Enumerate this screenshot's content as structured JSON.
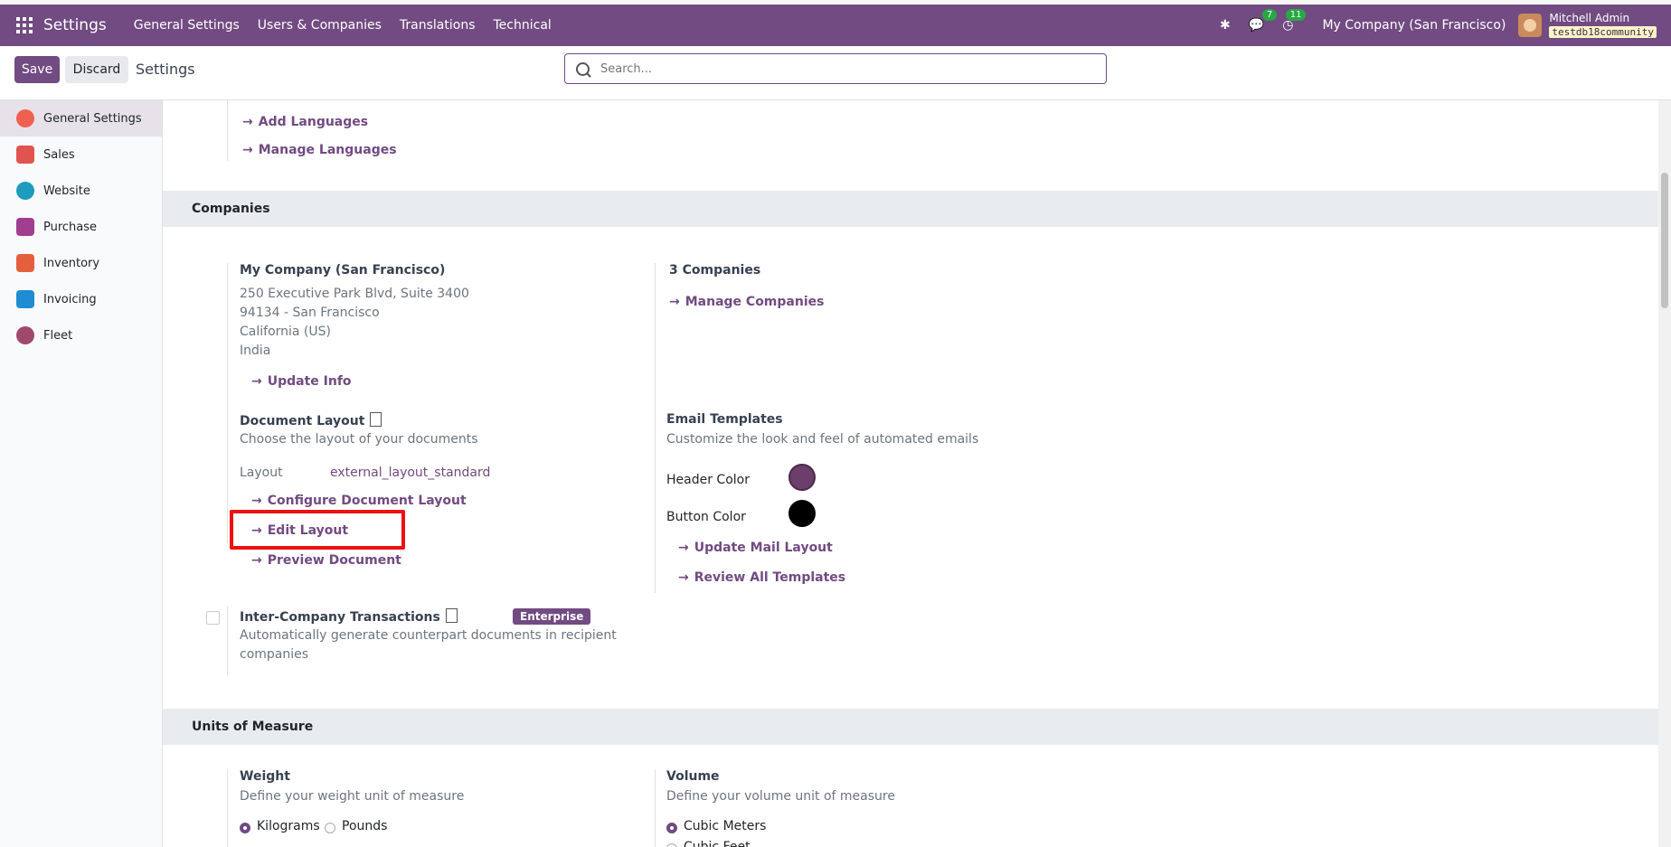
{
  "topbar": {
    "brand": "Settings",
    "nav": [
      "General Settings",
      "Users & Companies",
      "Translations",
      "Technical"
    ],
    "messages_count": "7",
    "activities_count": "11",
    "company": "My Company (San Francisco)",
    "user_name": "Mitchell Admin",
    "db_name": "testdb18community"
  },
  "controls": {
    "save": "Save",
    "discard": "Discard",
    "breadcrumb": "Settings",
    "search_placeholder": "Search..."
  },
  "sidebar": {
    "items": [
      {
        "label": "General Settings",
        "color": "#f06050"
      },
      {
        "label": "Sales",
        "color": "#e1534f"
      },
      {
        "label": "Website",
        "color": "#1e9cbd"
      },
      {
        "label": "Purchase",
        "color": "#a23e8f"
      },
      {
        "label": "Inventory",
        "color": "#e45f3b"
      },
      {
        "label": "Invoicing",
        "color": "#1f8cd3"
      },
      {
        "label": "Fleet",
        "color": "#a1496c"
      }
    ]
  },
  "languages": {
    "add": "Add Languages",
    "manage": "Manage Languages"
  },
  "companies": {
    "title": "Companies",
    "company_name": "My Company (San Francisco)",
    "address1": "250 Executive Park Blvd, Suite 3400",
    "address2": "94134 - San Francisco",
    "address3": "California (US)",
    "address4": "India",
    "update_info": "Update Info",
    "count": "3 Companies",
    "manage": "Manage Companies",
    "doc_layout_title": "Document Layout",
    "doc_layout_desc": "Choose the layout of your documents",
    "layout_label": "Layout",
    "layout_value": "external_layout_standard",
    "configure": "Configure Document Layout",
    "edit": "Edit Layout",
    "preview": "Preview Document",
    "email_title": "Email Templates",
    "email_desc": "Customize the look and feel of automated emails",
    "header_color_label": "Header Color",
    "header_color": "#6b3e6b",
    "button_color_label": "Button Color",
    "button_color": "#000000",
    "update_mail": "Update Mail Layout",
    "review_templates": "Review All Templates",
    "intercompany_title": "Inter-Company Transactions",
    "intercompany_badge": "Enterprise",
    "intercompany_desc1": "Automatically generate counterpart documents in recipient",
    "intercompany_desc2": "companies"
  },
  "uom": {
    "title": "Units of Measure",
    "weight_title": "Weight",
    "weight_desc": "Define your weight unit of measure",
    "kilograms": "Kilograms",
    "pounds": "Pounds",
    "volume_title": "Volume",
    "volume_desc": "Define your volume unit of measure",
    "cubic_meters": "Cubic Meters",
    "cubic_feet": "Cubic Feet"
  }
}
